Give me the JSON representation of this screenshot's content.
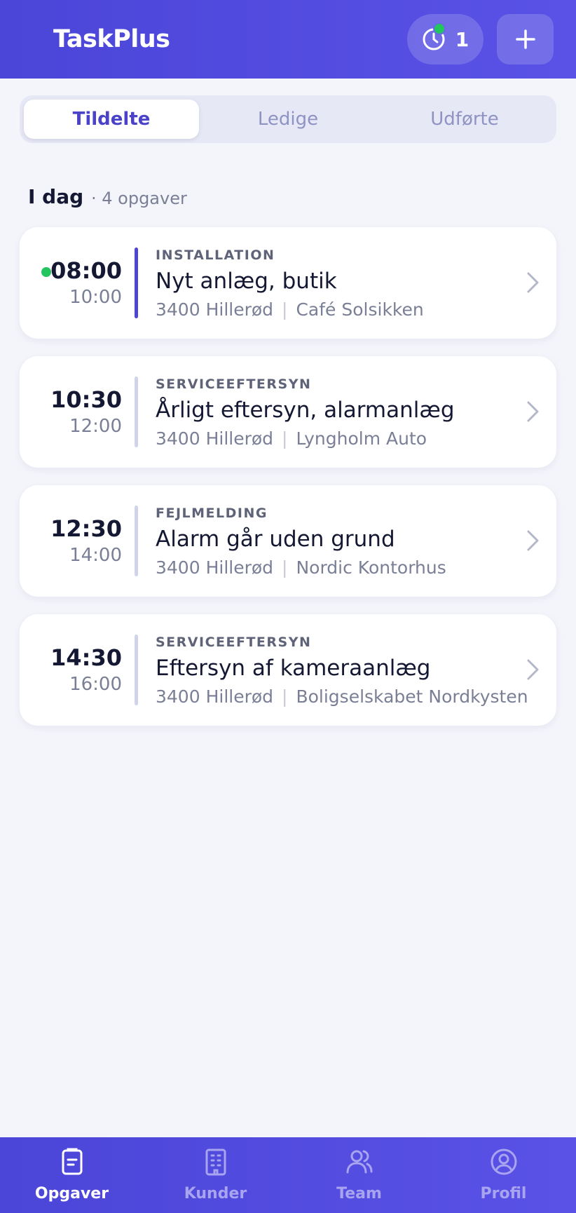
{
  "header": {
    "title": "TaskPlus",
    "active_timers": "1"
  },
  "tabs": [
    {
      "label": "Tildelte",
      "active": true
    },
    {
      "label": "Ledige",
      "active": false
    },
    {
      "label": "Udførte",
      "active": false
    }
  ],
  "section": {
    "title": "I dag",
    "count": "· 4 opgaver"
  },
  "tasks": [
    {
      "start": "08:00",
      "end": "10:00",
      "category": "INSTALLATION",
      "title": "Nyt anlæg, butik",
      "location": "3400 Hillerød",
      "customer": "Café Solsikken",
      "in_progress": true
    },
    {
      "start": "10:30",
      "end": "12:00",
      "category": "SERVICEEFTERSYN",
      "title": "Årligt eftersyn, alarmanlæg",
      "location": "3400 Hillerød",
      "customer": "Lyngholm Auto",
      "in_progress": false
    },
    {
      "start": "12:30",
      "end": "14:00",
      "category": "FEJLMELDING",
      "title": "Alarm går uden grund",
      "location": "3400 Hillerød",
      "customer": "Nordic Kontorhus",
      "in_progress": false
    },
    {
      "start": "14:30",
      "end": "16:00",
      "category": "SERVICEEFTERSYN",
      "title": "Eftersyn af kameraanlæg",
      "location": "3400 Hillerød",
      "customer": "Boligselskabet Nordkysten",
      "in_progress": false
    }
  ],
  "nav": [
    {
      "label": "Opgaver",
      "icon": "clipboard-icon",
      "active": true
    },
    {
      "label": "Kunder",
      "icon": "building-icon",
      "active": false
    },
    {
      "label": "Team",
      "icon": "users-icon",
      "active": false
    },
    {
      "label": "Profil",
      "icon": "user-circle-icon",
      "active": false
    }
  ],
  "colors": {
    "brand": "#4b45d8",
    "live": "#22c55e",
    "accent_text": "#4a43c9"
  }
}
